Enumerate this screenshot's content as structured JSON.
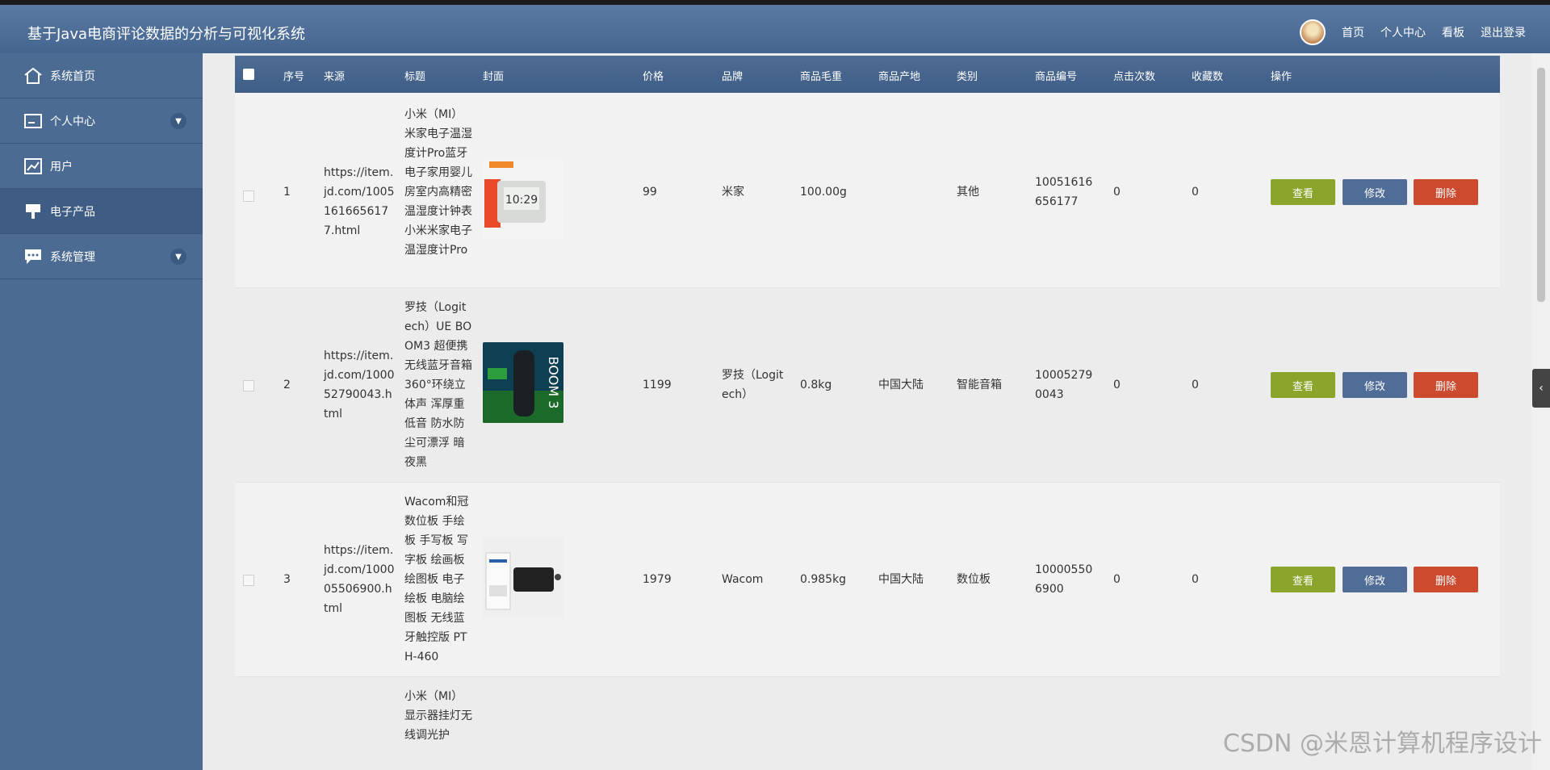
{
  "app": {
    "title": "基于Java电商评论数据的分析与可视化系统"
  },
  "topnav": {
    "home": "首页",
    "profile": "个人中心",
    "dashboard": "看板",
    "logout": "退出登录"
  },
  "sidebar": {
    "items": [
      {
        "label": "系统首页",
        "icon": "home-icon"
      },
      {
        "label": "个人中心",
        "icon": "card-icon",
        "expandable": true
      },
      {
        "label": "用户",
        "icon": "chart-icon"
      },
      {
        "label": "电子产品",
        "icon": "monitor-icon",
        "active": true
      },
      {
        "label": "系统管理",
        "icon": "chat-icon",
        "expandable": true
      }
    ]
  },
  "table": {
    "headers": [
      "序号",
      "来源",
      "标题",
      "封面",
      "价格",
      "品牌",
      "商品毛重",
      "商品产地",
      "类别",
      "商品编号",
      "点击次数",
      "收藏数",
      "操作"
    ],
    "rows": [
      {
        "index": "1",
        "source": "https://item.jd.com/10051616656177.html",
        "title": "小米（MI）米家电子温湿度计Pro蓝牙电子家用婴儿房室内高精密温湿度计钟表 小米米家电子温湿度计Pro",
        "price": "99",
        "brand": "米家",
        "weight": "100.00g",
        "origin": "",
        "category": "其他",
        "sku": "10051616656177",
        "clicks": "0",
        "favorites": "0"
      },
      {
        "index": "2",
        "source": "https://item.jd.com/100052790043.html",
        "title": "罗技（Logitech）UE BOOM3 超便携无线蓝牙音箱 360°环绕立体声 浑厚重低音 防水防尘可漂浮 暗夜黑",
        "price": "1199",
        "brand": "罗技（Logitech）",
        "weight": "0.8kg",
        "origin": "中国大陆",
        "category": "智能音箱",
        "sku": "100052790043",
        "clicks": "0",
        "favorites": "0"
      },
      {
        "index": "3",
        "source": "https://item.jd.com/100005506900.html",
        "title": "Wacom和冠数位板 手绘板 手写板 写字板 绘画板 绘图板 电子绘板 电脑绘图板 无线蓝牙触控版 PTH-460",
        "price": "1979",
        "brand": "Wacom",
        "weight": "0.985kg",
        "origin": "中国大陆",
        "category": "数位板",
        "sku": "100005506900",
        "clicks": "0",
        "favorites": "0"
      },
      {
        "index": "",
        "source": "",
        "title": "小米（MI）显示器挂灯无线调光护",
        "price": "",
        "brand": "",
        "weight": "",
        "origin": "",
        "category": "",
        "sku": "",
        "clicks": "",
        "favorites": ""
      }
    ],
    "actions": {
      "view": "查看",
      "edit": "修改",
      "delete": "删除"
    }
  },
  "watermark": "CSDN @米恩计算机程序设计",
  "colors": {
    "header": "#4e6c94",
    "view": "#8aa52a",
    "edit": "#4f6d97",
    "delete": "#cc4a2e"
  }
}
